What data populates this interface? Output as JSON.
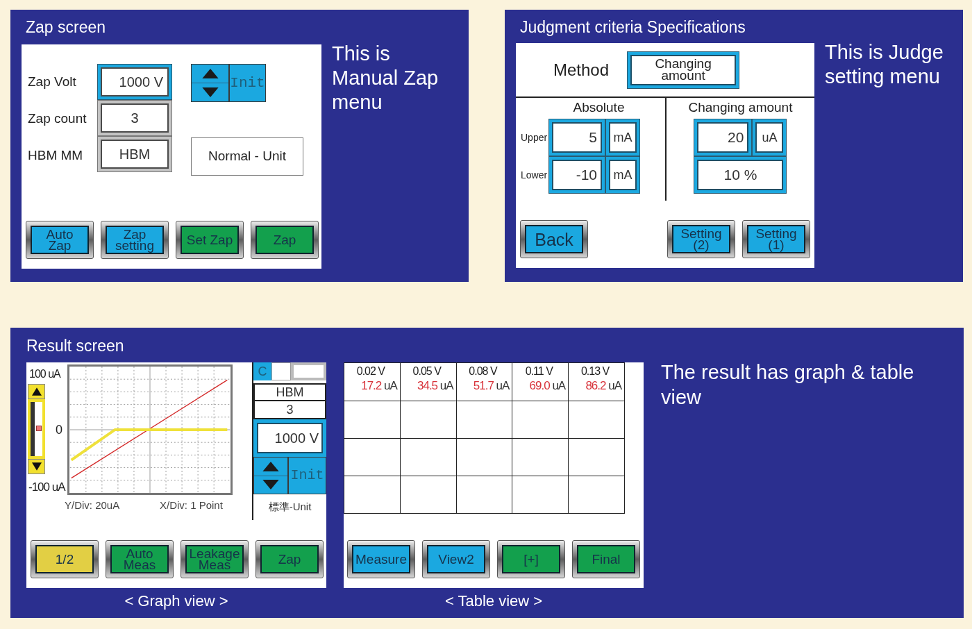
{
  "zap_screen": {
    "title": "Zap screen",
    "fields": [
      {
        "label": "Zap Volt",
        "value": "1000 V",
        "selected": true
      },
      {
        "label": "Zap count",
        "value": "3",
        "selected": false
      },
      {
        "label": "HBM MM",
        "value": "HBM",
        "selected": false
      }
    ],
    "init_button": "Init",
    "unit_label": "Normal - Unit",
    "buttons": [
      {
        "label": "Auto Zap",
        "color": "#1ba8e0"
      },
      {
        "label": "Zap setting",
        "color": "#1ba8e0"
      },
      {
        "label": "Set Zap",
        "color": "#13a04d"
      },
      {
        "label": "Zap",
        "color": "#13a04d"
      }
    ],
    "caption": "This is Manual Zap menu"
  },
  "judge_screen": {
    "title": "Judgment criteria Specifications",
    "method_label": "Method",
    "method_value": "Changing amount",
    "absolute": {
      "title": "Absolute",
      "rows": [
        {
          "label": "Upper",
          "value": "5",
          "unit": "mA"
        },
        {
          "label": "Lower",
          "value": "-10",
          "unit": "mA"
        }
      ]
    },
    "changing": {
      "title": "Changing amount",
      "value": "20",
      "unit": "uA",
      "percent": "10 %"
    },
    "buttons": [
      {
        "label": "Back",
        "color": "#1ba8e0"
      },
      {
        "label": "Setting (2)",
        "color": "#1ba8e0"
      },
      {
        "label": "Setting (1)",
        "color": "#1ba8e0"
      }
    ],
    "caption": "This is Judge setting menu"
  },
  "result_screen": {
    "title": "Result screen",
    "graph": {
      "y_top": "100 uA",
      "y_mid": "0",
      "y_bottom": "-100 uA",
      "y_div": "Y/Div: 20uA",
      "x_div": "X/Div: 1 Point",
      "mode": "C",
      "method": "HBM",
      "count": "3",
      "volt": "1000 V",
      "init_button": "Init",
      "unit_label": "標準-Unit",
      "buttons": [
        {
          "label": "1/2",
          "color": "#e2cf44"
        },
        {
          "label": "Auto Meas",
          "color": "#13a04d"
        },
        {
          "label": "Leakage Meas",
          "color": "#13a04d"
        },
        {
          "label": "Zap",
          "color": "#13a04d"
        }
      ],
      "caption": "< Graph view >"
    },
    "table": {
      "columns": [
        {
          "voltage": "0.02 V",
          "current": "17.2",
          "unit": "uA"
        },
        {
          "voltage": "0.05 V",
          "current": "34.5",
          "unit": "uA"
        },
        {
          "voltage": "0.08 V",
          "current": "51.7",
          "unit": "uA"
        },
        {
          "voltage": "0.11 V",
          "current": "69.0",
          "unit": "uA"
        },
        {
          "voltage": "0.13 V",
          "current": "86.2",
          "unit": "uA"
        }
      ],
      "buttons": [
        {
          "label": "Measure",
          "color": "#1ba8e0"
        },
        {
          "label": "View2",
          "color": "#1ba8e0"
        },
        {
          "label": "[+]",
          "color": "#13a04d"
        },
        {
          "label": "Final",
          "color": "#13a04d"
        }
      ],
      "caption": "< Table view >"
    },
    "caption": "The result has graph & table view"
  }
}
